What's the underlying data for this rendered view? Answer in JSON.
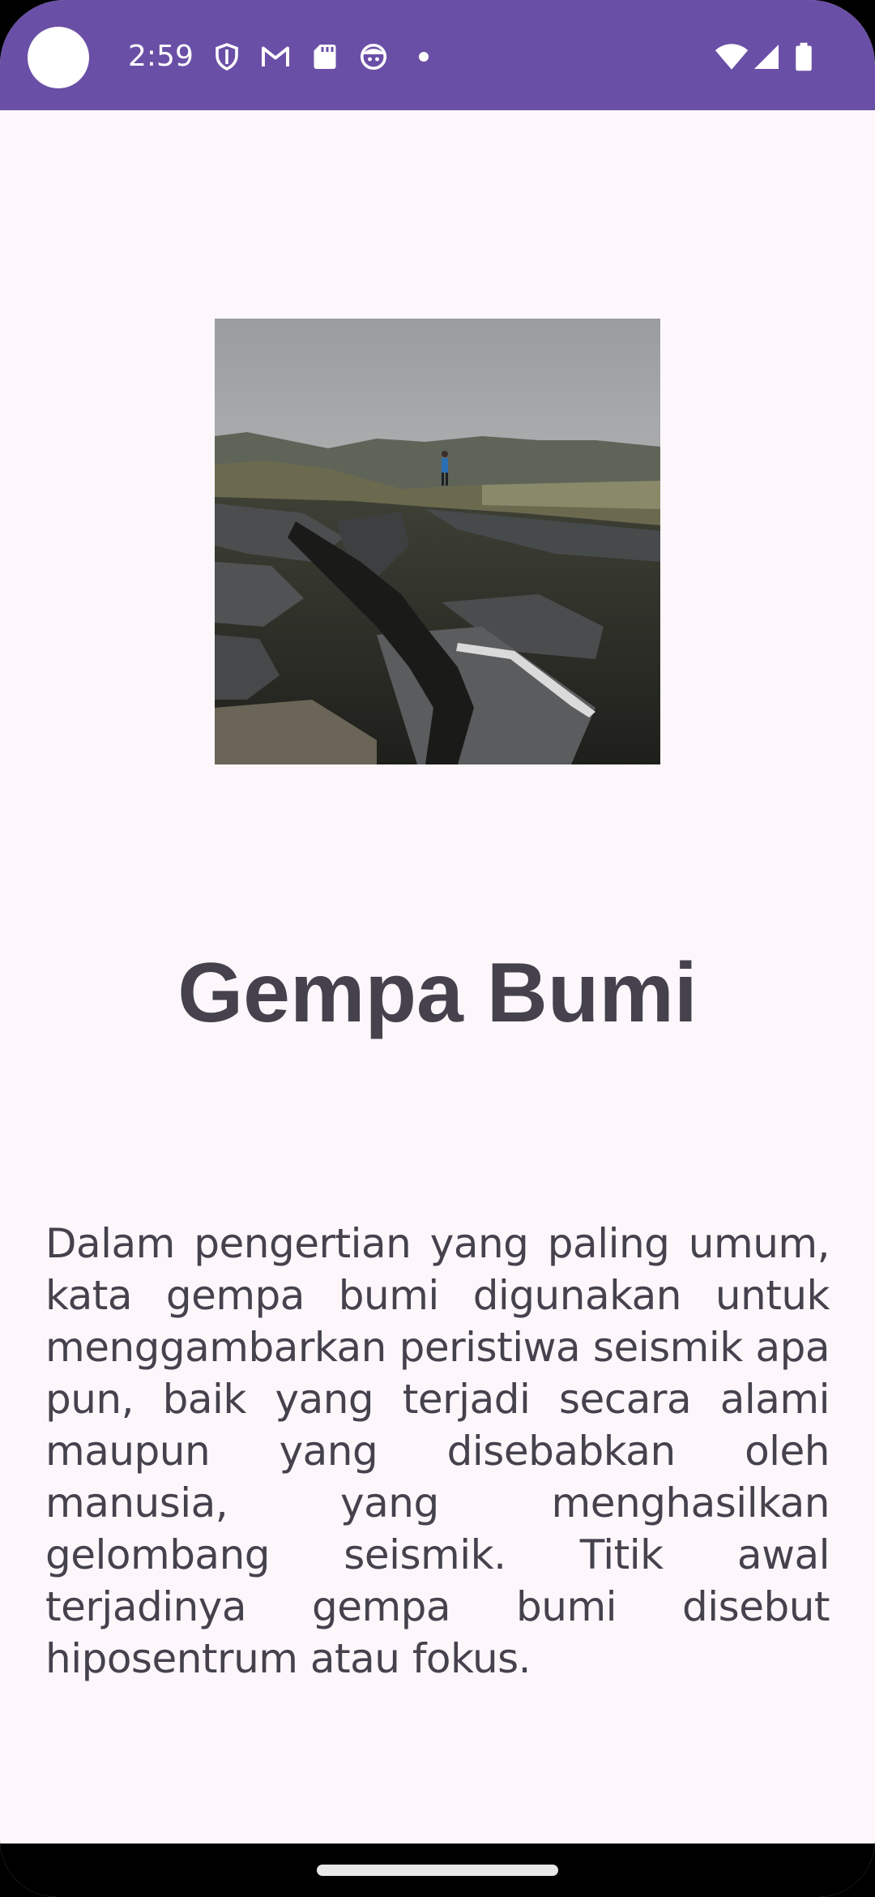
{
  "status_bar": {
    "time": "2:59",
    "background_color": "#6a4fa6",
    "left_icons": [
      "vpn-shield-icon",
      "gmail-icon",
      "sd-card-icon",
      "face-icon",
      "notification-dot-icon"
    ],
    "right_icons": [
      "wifi-icon",
      "cellular-signal-icon",
      "battery-icon"
    ]
  },
  "content": {
    "image_alt": "cracked road after earthquake with person standing",
    "title": "Gempa Bumi",
    "description": "Dalam pengertian yang paling umum, kata gempa bumi digunakan untuk menggambarkan peristiwa seismik apa pun, baik yang terjadi secara alami maupun yang disebabkan oleh manusia, yang menghasilkan gelombang seismik. Titik awal terjadinya gempa bumi disebut hiposentrum atau fokus."
  },
  "colors": {
    "background": "#fdf7fb",
    "text": "#45424e",
    "accent": "#6a4fa6"
  }
}
